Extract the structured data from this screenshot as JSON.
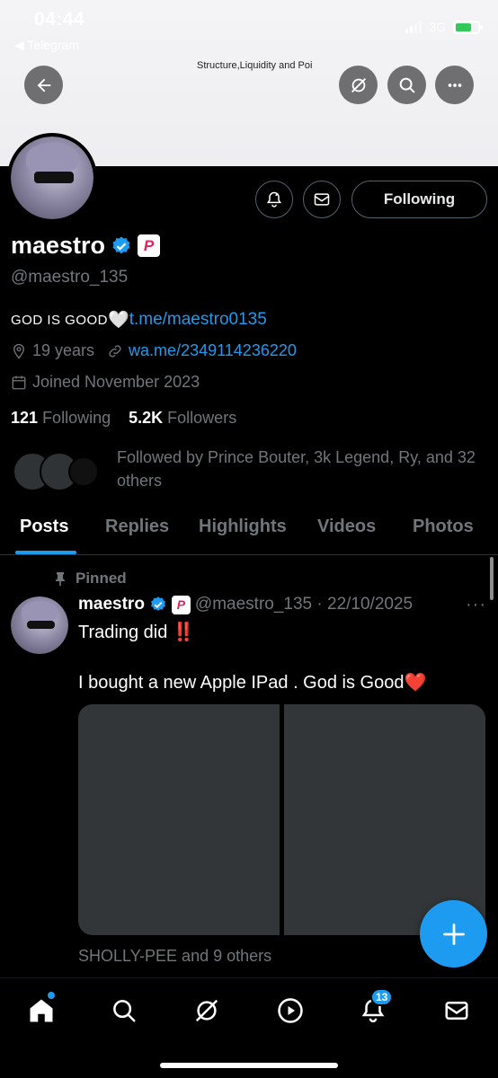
{
  "status_bar": {
    "time": "04:44",
    "back_app": "◀ Telegram",
    "network": "3G"
  },
  "banner": {
    "title": "Structure,Liquidity and Poi"
  },
  "header_buttons": {
    "back": "back",
    "grok": "grok",
    "search": "search",
    "more": "more"
  },
  "profile": {
    "follow_label": "Following",
    "name": "maestro",
    "handle": "@maestro_135",
    "bio_text": "GOD IS GOOD",
    "bio_heart": "🤍",
    "bio_link": "t.me/maestro0135",
    "location": "19 years",
    "website": "wa.me/2349114236220",
    "joined": "Joined November 2023",
    "following_count": "121",
    "following_label": "Following",
    "followers_count": "5.2K",
    "followers_label": "Followers",
    "followed_by": "Followed by Prince Bouter, 3k Legend, Ry, and 32 others"
  },
  "tabs": [
    "Posts",
    "Replies",
    "Highlights",
    "Videos",
    "Photos"
  ],
  "post": {
    "pinned_label": "Pinned",
    "author": "maestro",
    "meta": "@maestro_135 · 22/10/2025",
    "more": "···",
    "line1": "Trading did ",
    "line1_emoji": "‼️",
    "line2": "I bought a new Apple IPad .   God is Good",
    "line2_emoji": "❤️",
    "likers": "SHOLLY-PEE and 9 others"
  },
  "nav": {
    "notifications_badge": "13"
  },
  "colors": {
    "accent": "#1d9bf0",
    "background": "#000000",
    "muted": "#71767b"
  }
}
